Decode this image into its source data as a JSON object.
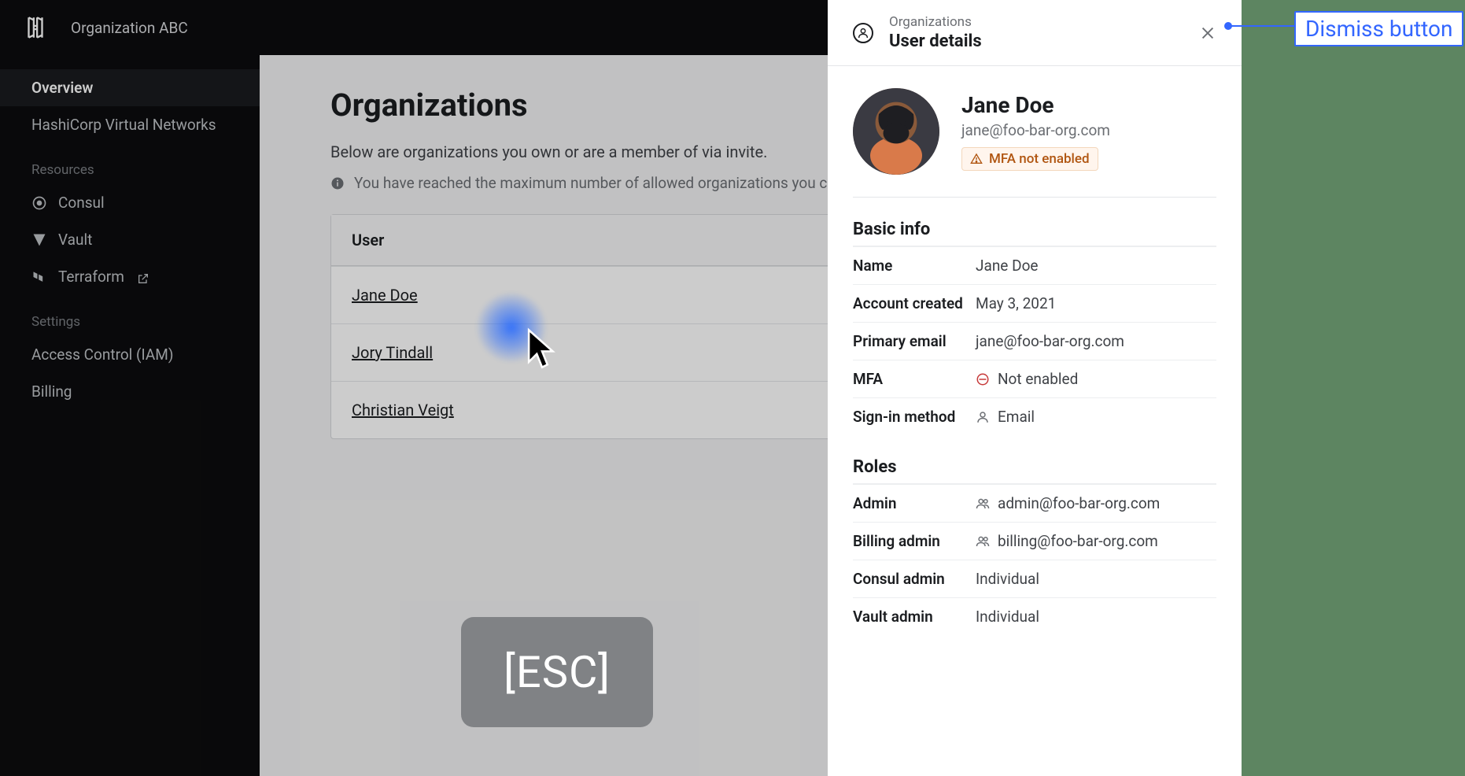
{
  "header": {
    "org_name": "Organization ABC"
  },
  "sidebar": {
    "items_top": [
      {
        "label": "Overview"
      },
      {
        "label": "HashiCorp Virtual Networks"
      }
    ],
    "section_resources": "Resources",
    "items_resources": [
      {
        "label": "Consul"
      },
      {
        "label": "Vault"
      },
      {
        "label": "Terraform"
      }
    ],
    "section_settings": "Settings",
    "items_settings": [
      {
        "label": "Access Control (IAM)"
      },
      {
        "label": "Billing"
      }
    ]
  },
  "main": {
    "title": "Organizations",
    "subtitle": "Below are organizations you own or are a member of via invite.",
    "alert": "You have reached the maximum number of allowed organizations you can create.",
    "table_header": "User",
    "rows": [
      {
        "name": "Jane Doe"
      },
      {
        "name": "Jory Tindall"
      },
      {
        "name": "Christian Veigt"
      }
    ]
  },
  "esc_label": "[ESC]",
  "drawer": {
    "breadcrumb": "Organizations",
    "title": "User details",
    "profile": {
      "name": "Jane Doe",
      "email": "jane@foo-bar-org.com",
      "mfa_badge": "MFA not enabled"
    },
    "basic_info_title": "Basic info",
    "basic_info": {
      "name_label": "Name",
      "name_value": "Jane Doe",
      "created_label": "Account created",
      "created_value": "May 3, 2021",
      "email_label": "Primary email",
      "email_value": "jane@foo-bar-org.com",
      "mfa_label": "MFA",
      "mfa_value": "Not enabled",
      "signin_label": "Sign-in method",
      "signin_value": "Email"
    },
    "roles_title": "Roles",
    "roles": {
      "admin_label": "Admin",
      "admin_value": "admin@foo-bar-org.com",
      "billing_label": "Billing admin",
      "billing_value": "billing@foo-bar-org.com",
      "consul_label": "Consul admin",
      "consul_value": "Individual",
      "vault_label": "Vault admin",
      "vault_value": "Individual"
    }
  },
  "callout": "Dismiss button"
}
